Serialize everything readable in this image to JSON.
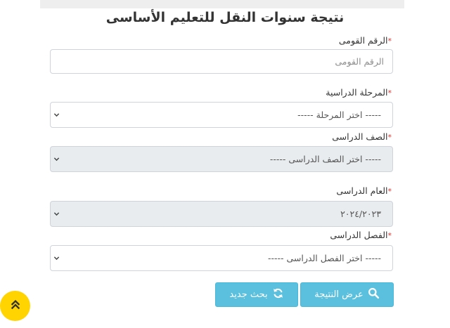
{
  "page": {
    "title": "نتيجة سنوات النقل للتعليم الأساسى",
    "required_mark": "*"
  },
  "form": {
    "national_id": {
      "label": "الرقم القومى",
      "placeholder": "الرقم القومى"
    },
    "stage": {
      "label": "المرحلة الدراسية",
      "selected": "-----  اختر المرحلة  -----"
    },
    "grade": {
      "label": "الصف الدراسى",
      "selected": "-----  اختر الصف الدراسى  -----"
    },
    "year": {
      "label": "العام الدراسى",
      "selected": "٢٠٢٤/٢٠٢٣"
    },
    "term": {
      "label": "الفصل الدراسى",
      "selected": "-----  اختر الفصل الدراسى  -----"
    }
  },
  "buttons": {
    "show_result": "عرض النتيجة",
    "new_search": "بحث جديد"
  },
  "icons": {
    "chevron": "chevron-down-icon",
    "search": "search-icon",
    "refresh": "refresh-icon",
    "scroll_top": "double-chevron-up-icon"
  },
  "colors": {
    "button": "#5bc0de",
    "required": "#e3342f",
    "scroll_top": "#ffd400",
    "disabled_field": "#e9ecef"
  }
}
